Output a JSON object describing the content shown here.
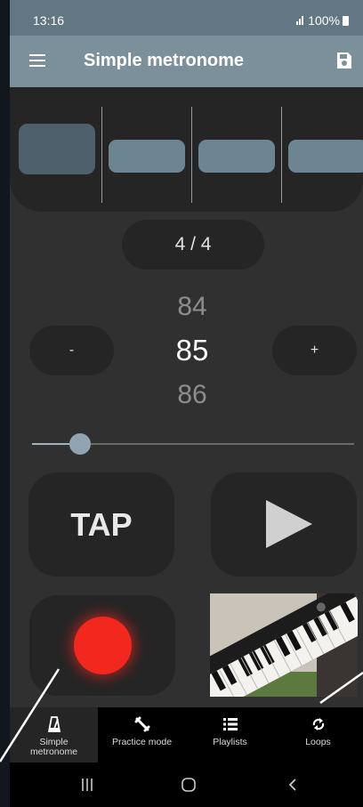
{
  "status_bar": {
    "time": "13:16",
    "battery": "100%"
  },
  "app_bar": {
    "title": "Simple metronome"
  },
  "beats": {
    "count": 4,
    "active_index": 0
  },
  "time_signature": "4 / 4",
  "tempo": {
    "minus_label": "-",
    "plus_label": "+",
    "prev": "84",
    "current": "85",
    "next": "86",
    "slider_level": 0.15
  },
  "controls": {
    "tap_label": "TAP"
  },
  "bottom_nav": {
    "items": [
      {
        "label": "Simple metronome",
        "icon": "metronome-icon",
        "active": true
      },
      {
        "label": "Practice mode",
        "icon": "practice-icon",
        "active": false
      },
      {
        "label": "Playlists",
        "icon": "playlist-icon",
        "active": false
      },
      {
        "label": "Loops",
        "icon": "loop-icon",
        "active": false
      }
    ]
  },
  "colors": {
    "status_bar": "#637684",
    "app_bar": "#7c909c",
    "beat_block": "#6d8492",
    "beat_active": "#4e606b",
    "record": "#f2271d",
    "background": "#303030",
    "button": "#252525"
  }
}
